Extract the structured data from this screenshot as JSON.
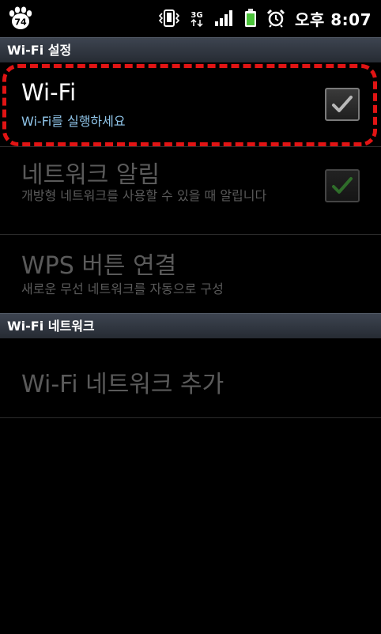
{
  "status_bar": {
    "badge_number": "74",
    "network_type": "3G",
    "time": "오후 8:07",
    "icons": [
      "vibrate-icon",
      "network-3g-icon",
      "signal-icon",
      "battery-icon",
      "alarm-icon"
    ]
  },
  "sections": {
    "wifi_settings": "Wi-Fi 설정",
    "wifi_networks": "Wi-Fi 네트워크"
  },
  "rows": {
    "wifi": {
      "title": "Wi-Fi",
      "subtitle": "Wi-Fi를 실행하세요",
      "checked": true
    },
    "network_notification": {
      "title": "네트워크 알림",
      "subtitle": "개방형 네트워크를 사용할 수 있을 때 알립니다",
      "checked": true
    },
    "wps": {
      "title": "WPS 버튼 연결",
      "subtitle": "새로운 무선 네트워크를 자동으로 구성"
    },
    "add_network": {
      "title": "Wi-Fi 네트워크 추가"
    }
  },
  "colors": {
    "background": "#000000",
    "header_bg": "#2f353e",
    "title_active": "#ffffff",
    "subtitle_active": "#8fc4e8",
    "text_dim": "#5a5a5a",
    "highlight": "#e11414",
    "check_active": "#b9b9b9",
    "check_dim": "#2f6d2a"
  }
}
